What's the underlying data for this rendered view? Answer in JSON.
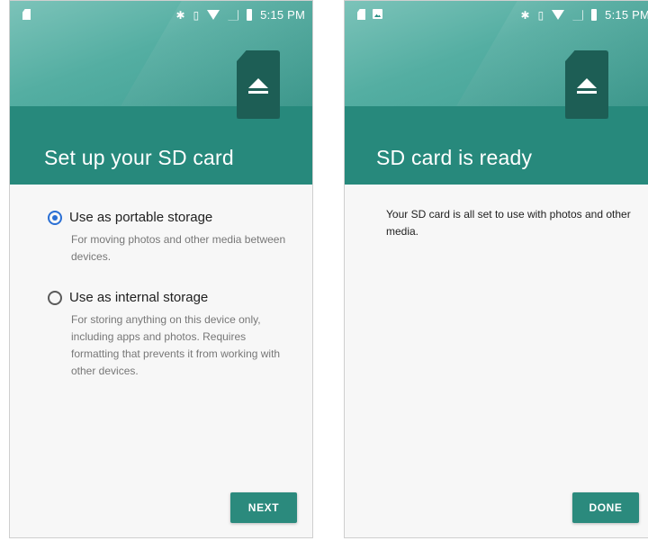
{
  "colors": {
    "header_dark": "#27897c",
    "header_light": "#54aea2",
    "radio_accent": "#2a6fd4",
    "button": "#2b8a7d"
  },
  "screen_setup": {
    "status": {
      "time": "5:15 PM",
      "left_icons": [
        "sd-card-icon"
      ],
      "right_icons": [
        "bluetooth-icon",
        "vibrate-icon",
        "wifi-icon",
        "signal-icon",
        "battery-icon"
      ]
    },
    "title": "Set up your SD card",
    "options": [
      {
        "label": "Use as portable storage",
        "description": "For moving photos and other media between devices.",
        "selected": true
      },
      {
        "label": "Use as internal storage",
        "description": "For storing anything on this device only, including apps and photos. Requires formatting that prevents it from working with other devices.",
        "selected": false
      }
    ],
    "button_label": "NEXT"
  },
  "screen_ready": {
    "status": {
      "time": "5:15 PM",
      "left_icons": [
        "sd-card-icon",
        "image-icon"
      ],
      "right_icons": [
        "bluetooth-icon",
        "vibrate-icon",
        "wifi-icon",
        "signal-icon",
        "battery-icon"
      ]
    },
    "title": "SD card is ready",
    "body": "Your SD card is all set to use with photos and other media.",
    "button_label": "DONE"
  }
}
